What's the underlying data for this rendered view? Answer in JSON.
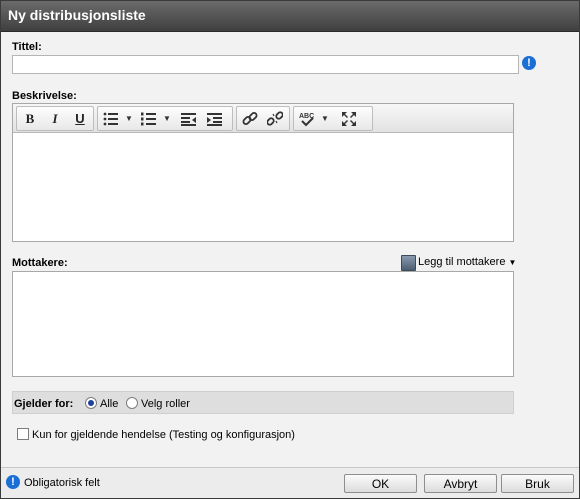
{
  "dialog": {
    "title": "Ny distribusjonsliste"
  },
  "title_field": {
    "label": "Tittel:",
    "value": "",
    "required_icon": "info-icon"
  },
  "description": {
    "label": "Beskrivelse:",
    "toolbar": {
      "bold": "B",
      "italic": "I",
      "underline": "U",
      "bullet_list_icon": "bullet-list-icon",
      "numbered_list_icon": "numbered-list-icon",
      "outdent_icon": "outdent-icon",
      "indent_icon": "indent-icon",
      "link_icon": "link-icon",
      "unlink_icon": "unlink-icon",
      "spellcheck_icon": "spellcheck-icon",
      "maximize_icon": "maximize-icon"
    },
    "value": ""
  },
  "recipients": {
    "label": "Mottakere:",
    "add_label": "Legg til mottakere"
  },
  "applies_to": {
    "label": "Gjelder for:",
    "options": [
      {
        "label": "Alle",
        "selected": true
      },
      {
        "label": "Velg roller",
        "selected": false
      }
    ]
  },
  "current_event_only": {
    "label": "Kun for gjeldende hendelse (Testing og konfigurasjon)",
    "checked": false
  },
  "footer": {
    "required_note": "Obligatorisk felt",
    "ok_label": "OK",
    "cancel_label": "Avbryt",
    "apply_label": "Bruk"
  },
  "colors": {
    "titlebar": "#4f4f4f",
    "accent": "#1a6fd6"
  }
}
